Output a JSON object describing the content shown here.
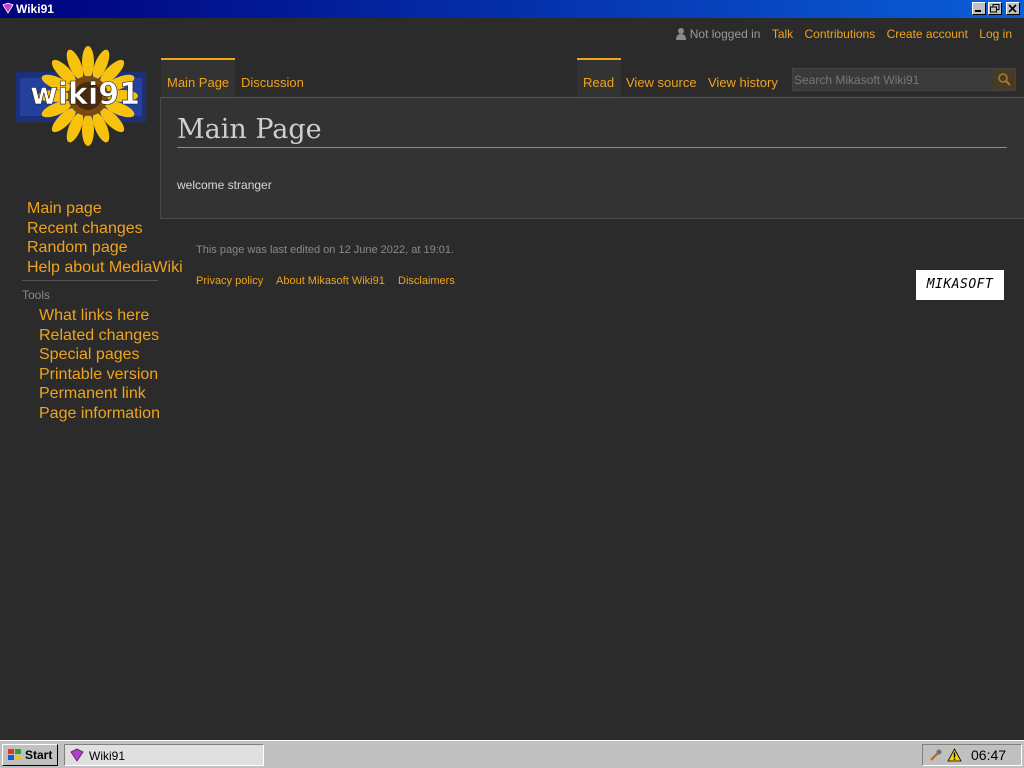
{
  "window": {
    "title": "Wiki91"
  },
  "logo": {
    "text": "wiki91"
  },
  "personal": {
    "not_logged_in": "Not logged in",
    "talk": "Talk",
    "contributions": "Contributions",
    "create_account": "Create account",
    "log_in": "Log in"
  },
  "tabs": {
    "main_page": "Main Page",
    "discussion": "Discussion",
    "read": "Read",
    "view_source": "View source",
    "view_history": "View history"
  },
  "search": {
    "placeholder": "Search Mikasoft Wiki91"
  },
  "page": {
    "title": "Main Page",
    "body": "welcome stranger"
  },
  "sidebar": {
    "navigation": [
      "Main page",
      "Recent changes",
      "Random page",
      "Help about MediaWiki"
    ],
    "tools_heading": "Tools",
    "tools": [
      "What links here",
      "Related changes",
      "Special pages",
      "Printable version",
      "Permanent link",
      "Page information"
    ]
  },
  "footer": {
    "last_modified": "This page was last edited on 12 June 2022, at 19:01.",
    "links": [
      "Privacy policy",
      "About Mikasoft Wiki91",
      "Disclaimers"
    ],
    "badge": "MIKASOFT"
  },
  "taskbar": {
    "start": "Start",
    "task": "Wiki91",
    "clock": "06:47"
  },
  "colors": {
    "accent": "#f0a31c",
    "background": "#2b2b2b",
    "content": "#333333"
  }
}
